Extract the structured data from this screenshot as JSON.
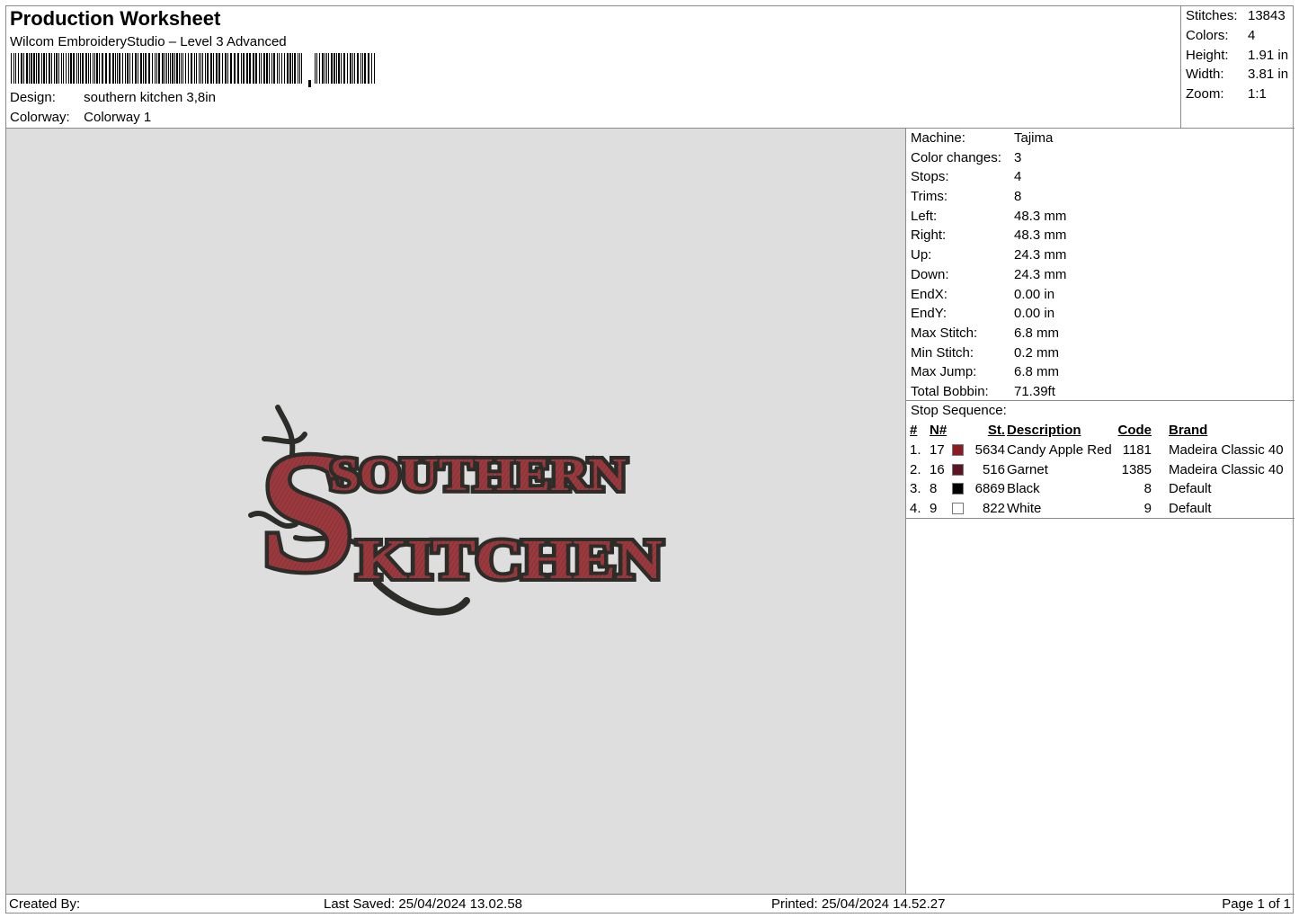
{
  "header": {
    "title": "Production Worksheet",
    "software": "Wilcom EmbroideryStudio – Level 3 Advanced",
    "design_label": "Design:",
    "design_value": "southern kitchen 3,8in",
    "colorway_label": "Colorway:",
    "colorway_value": "Colorway 1"
  },
  "summary": [
    {
      "label": "Stitches:",
      "value": "13843"
    },
    {
      "label": "Colors:",
      "value": "4"
    },
    {
      "label": "Height:",
      "value": "1.91 in"
    },
    {
      "label": "Width:",
      "value": "3.81 in"
    },
    {
      "label": "Zoom:",
      "value": "1:1"
    }
  ],
  "machine": [
    {
      "label": "Machine:",
      "value": "Tajima"
    },
    {
      "label": "Color changes:",
      "value": "3"
    },
    {
      "label": "Stops:",
      "value": "4"
    },
    {
      "label": "Trims:",
      "value": "8"
    },
    {
      "label": "Left:",
      "value": "48.3 mm"
    },
    {
      "label": "Right:",
      "value": "48.3 mm"
    },
    {
      "label": "Up:",
      "value": "24.3 mm"
    },
    {
      "label": "Down:",
      "value": "24.3 mm"
    },
    {
      "label": "EndX:",
      "value": "0.00 in"
    },
    {
      "label": "EndY:",
      "value": "0.00 in"
    },
    {
      "label": "Max Stitch:",
      "value": "6.8 mm"
    },
    {
      "label": "Min Stitch:",
      "value": "0.2 mm"
    },
    {
      "label": "Max Jump:",
      "value": "6.8 mm"
    },
    {
      "label": "Total Bobbin:",
      "value": "71.39ft"
    }
  ],
  "stops": {
    "title": "Stop Sequence:",
    "headers": {
      "num": "#",
      "n": "N#",
      "st": "St.",
      "description": "Description",
      "code": "Code",
      "brand": "Brand"
    },
    "rows": [
      {
        "num": "1.",
        "n": "17",
        "color": "#8b1c24",
        "st": "5634",
        "description": "Candy Apple Red",
        "code": "1181",
        "brand": "Madeira Classic 40"
      },
      {
        "num": "2.",
        "n": "16",
        "color": "#5a1624",
        "st": "516",
        "description": "Garnet",
        "code": "1385",
        "brand": "Madeira Classic 40"
      },
      {
        "num": "3.",
        "n": "8",
        "color": "#000000",
        "st": "6869",
        "description": "Black",
        "code": "8",
        "brand": "Default"
      },
      {
        "num": "4.",
        "n": "9",
        "color": "#ffffff",
        "st": "822",
        "description": "White",
        "code": "9",
        "brand": "Default"
      }
    ]
  },
  "design": {
    "line1": "SOUTHERN",
    "line2": "KITCHEN",
    "initial": "S",
    "fill_color": "#9b3a3e",
    "outline_color": "#2c2c28"
  },
  "footer": {
    "created_by": "Created By:",
    "last_saved": "Last Saved: 25/04/2024 13.02.58",
    "printed": "Printed: 25/04/2024 14.52.27",
    "page": "Page 1 of 1"
  }
}
